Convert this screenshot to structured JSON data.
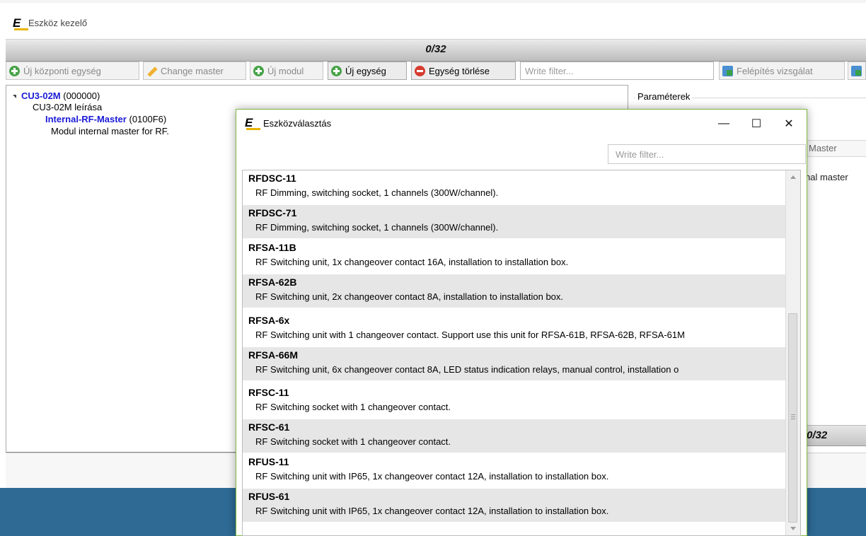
{
  "app": {
    "title": "Eszköz kezelő",
    "logo_letter": "E",
    "counter": "0/32"
  },
  "toolbar": {
    "new_central_unit": "Új központi egység",
    "change_master": "Change master",
    "new_module": "Új modul",
    "new_unit": "Új egység",
    "delete_unit": "Egység törlése",
    "filter_placeholder": "Write filter...",
    "build_check": "Felépítés vizsgálat"
  },
  "tree": {
    "root_name": "CU3-02M",
    "root_code": "(000000)",
    "root_desc": "CU3-02M leírása",
    "child_name": "Internal-RF-Master",
    "child_code": "(0100F6)",
    "child_desc": "Modul internal master for RF."
  },
  "params": {
    "legend": "Paraméterek",
    "field_value": "Master",
    "text_value": "nal master",
    "counter": "0/32"
  },
  "dialog": {
    "title": "Eszközválasztás",
    "filter_placeholder": "Write filter...",
    "controls": {
      "minimize": "—",
      "maximize": "☐",
      "close": "✕"
    },
    "items": [
      {
        "name": "RFDSC-11",
        "desc": "RF Dimming, switching socket, 1 channels (300W/channel)."
      },
      {
        "name": "RFDSC-71",
        "desc": "RF Dimming, switching socket, 1 channels (300W/channel)."
      },
      {
        "name": "RFSA-11B",
        "desc": "RF Switching unit, 1x changeover contact 16A, installation to installation box."
      },
      {
        "name": "RFSA-62B",
        "desc": "RF Switching unit, 2x changeover contact 8A, installation to installation box."
      },
      {
        "name": "RFSA-6x",
        "desc": "RF Switching unit with 1 changeover contact. Support use this unit for RFSA-61B, RFSA-62B, RFSA-61M"
      },
      {
        "name": "RFSA-66M",
        "desc": "RF Switching unit, 6x changeover contact 8A, LED status indication relays, manual control, installation o"
      },
      {
        "name": "RFSC-11",
        "desc": "RF Switching socket with 1 changeover contact."
      },
      {
        "name": "RFSC-61",
        "desc": "RF Switching socket with 1 changeover contact."
      },
      {
        "name": "RFUS-11",
        "desc": "RF Switching unit with IP65, 1x changeover contact 12A, installation to installation box."
      },
      {
        "name": "RFUS-61",
        "desc": "RF Switching unit with IP65, 1x changeover contact 12A, installation to installation box."
      }
    ]
  },
  "colors": {
    "dialog_border": "#7fb741",
    "tree_link": "#1a1ad6",
    "bottom_band": "#2e6a94",
    "alt_row": "#e6e6e6"
  }
}
